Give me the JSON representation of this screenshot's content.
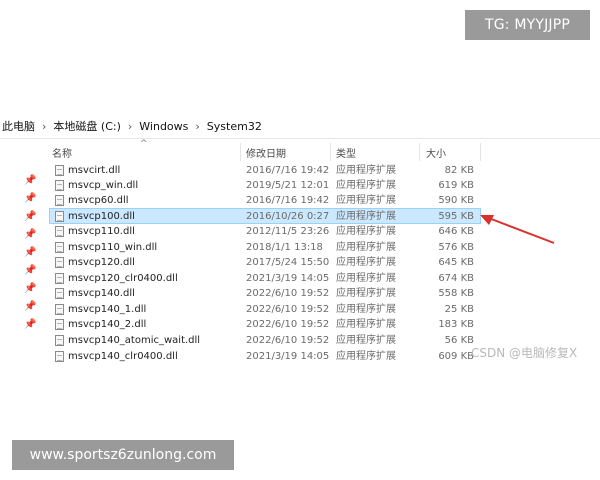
{
  "watermark_top": "TG: MYYJJPP",
  "watermark_bottom": "www.sportsz6zunlong.com",
  "csdn_label": "CSDN @电脑修复X",
  "breadcrumb": [
    "此电脑",
    "本地磁盘 (C:)",
    "Windows",
    "System32"
  ],
  "columns": {
    "name": "名称",
    "date": "修改日期",
    "type": "类型",
    "size": "大小"
  },
  "files": [
    {
      "name": "msvcirt.dll",
      "date": "2016/7/16 19:42",
      "type": "应用程序扩展",
      "size": "82 KB"
    },
    {
      "name": "msvcp_win.dll",
      "date": "2019/5/21 12:01",
      "type": "应用程序扩展",
      "size": "619 KB"
    },
    {
      "name": "msvcp60.dll",
      "date": "2016/7/16 19:42",
      "type": "应用程序扩展",
      "size": "590 KB"
    },
    {
      "name": "msvcp100.dll",
      "date": "2016/10/26 0:27",
      "type": "应用程序扩展",
      "size": "595 KB"
    },
    {
      "name": "msvcp110.dll",
      "date": "2012/11/5 23:26",
      "type": "应用程序扩展",
      "size": "646 KB"
    },
    {
      "name": "msvcp110_win.dll",
      "date": "2018/1/1 13:18",
      "type": "应用程序扩展",
      "size": "576 KB"
    },
    {
      "name": "msvcp120.dll",
      "date": "2017/5/24 15:50",
      "type": "应用程序扩展",
      "size": "645 KB"
    },
    {
      "name": "msvcp120_clr0400.dll",
      "date": "2021/3/19 14:05",
      "type": "应用程序扩展",
      "size": "674 KB"
    },
    {
      "name": "msvcp140.dll",
      "date": "2022/6/10 19:52",
      "type": "应用程序扩展",
      "size": "558 KB"
    },
    {
      "name": "msvcp140_1.dll",
      "date": "2022/6/10 19:52",
      "type": "应用程序扩展",
      "size": "25 KB"
    },
    {
      "name": "msvcp140_2.dll",
      "date": "2022/6/10 19:52",
      "type": "应用程序扩展",
      "size": "183 KB"
    },
    {
      "name": "msvcp140_atomic_wait.dll",
      "date": "2022/6/10 19:52",
      "type": "应用程序扩展",
      "size": "56 KB"
    },
    {
      "name": "msvcp140_clr0400.dll",
      "date": "2021/3/19 14:05",
      "type": "应用程序扩展",
      "size": "609 KB"
    }
  ],
  "selected_file": "msvcp100.dll",
  "icons": {
    "pin": "pin-icon",
    "file": "dll-file-icon",
    "sort": "sort-up-icon",
    "arrow": "red-arrow-annotation"
  },
  "colors": {
    "selection_bg": "#cce8ff",
    "selection_border": "#99d1ff",
    "arrow": "#d9312b",
    "badge": "#9a9a9a"
  }
}
